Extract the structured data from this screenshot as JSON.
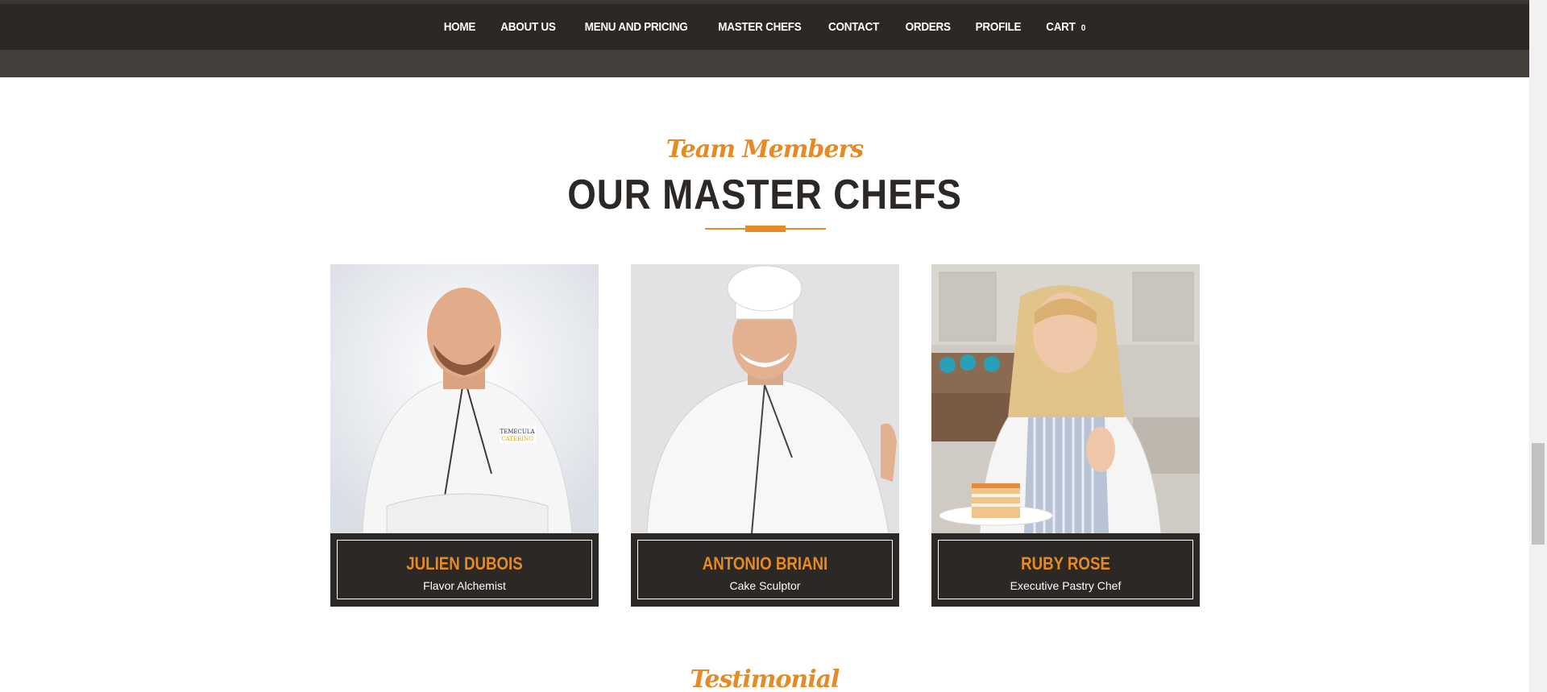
{
  "nav": {
    "items": [
      {
        "label": "HOME"
      },
      {
        "label": "ABOUT US"
      },
      {
        "label": "MENU AND PRICING"
      },
      {
        "label": "MASTER CHEFS"
      },
      {
        "label": "CONTACT"
      },
      {
        "label": "ORDERS"
      },
      {
        "label": "PROFILE"
      },
      {
        "label": "CART"
      }
    ],
    "cart_count": "0"
  },
  "section": {
    "subtitle": "Team Members",
    "title": "OUR MASTER CHEFS"
  },
  "chefs": [
    {
      "name": "JULIEN DUBOIS",
      "role": "Flavor Alchemist"
    },
    {
      "name": "ANTONIO BRIANI",
      "role": "Cake Sculptor"
    },
    {
      "name": "RUBY ROSE",
      "role": "Executive Pastry Chef"
    }
  ],
  "next_section": {
    "subtitle": "Testimonial"
  },
  "colors": {
    "accent": "#e58a25",
    "dark": "#2b2825"
  }
}
